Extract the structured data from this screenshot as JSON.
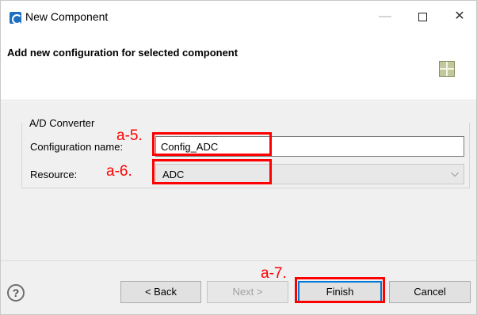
{
  "window": {
    "title": "New Component",
    "minimize_glyph": "—",
    "close_glyph": "✕"
  },
  "header": {
    "title": "Add new configuration for selected component"
  },
  "group": {
    "label": "A/D Converter"
  },
  "form": {
    "config_label": "Configuration name:",
    "config_value": "Config_ADC",
    "resource_label": "Resource:",
    "resource_value": "ADC",
    "chevron": "⌵"
  },
  "footer": {
    "help": "?",
    "back_label": "< Back",
    "next_label": "Next >",
    "finish_label": "Finish",
    "cancel_label": "Cancel"
  },
  "annotations": {
    "a5": "a-5.",
    "a6": "a-6.",
    "a7": "a-7."
  },
  "colors": {
    "annotation": "#ff0000",
    "accent": "#0078d7",
    "app_icon": "#1f6fc1"
  }
}
